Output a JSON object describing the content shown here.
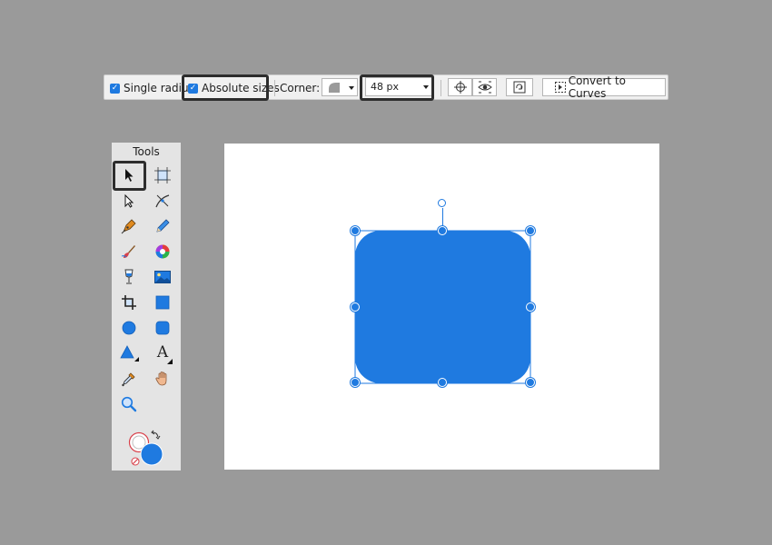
{
  "toolbar": {
    "single_radius": {
      "label": "Single radius",
      "checked": true
    },
    "absolute_sizes": {
      "label": "Absolute sizes",
      "checked": true
    },
    "corner_label": "Corner:",
    "radius_value": "48 px",
    "convert_label": "Convert to Curves"
  },
  "tools_panel": {
    "title": "Tools",
    "tools": [
      {
        "name": "move-tool-icon",
        "active": true
      },
      {
        "name": "artboard-tool-icon"
      },
      {
        "name": "node-tool-icon"
      },
      {
        "name": "corner-tool-icon"
      },
      {
        "name": "pen-tool-icon"
      },
      {
        "name": "pencil-tool-icon"
      },
      {
        "name": "brush-tool-icon"
      },
      {
        "name": "fill-tool-icon"
      },
      {
        "name": "transparency-tool-icon"
      },
      {
        "name": "place-image-tool-icon"
      },
      {
        "name": "crop-tool-icon"
      },
      {
        "name": "rectangle-tool-icon"
      },
      {
        "name": "ellipse-tool-icon"
      },
      {
        "name": "rounded-rectangle-tool-icon"
      },
      {
        "name": "triangle-tool-icon"
      },
      {
        "name": "text-tool-icon"
      },
      {
        "name": "color-picker-tool-icon"
      },
      {
        "name": "view-tool-icon"
      },
      {
        "name": "zoom-tool-icon"
      }
    ],
    "text_tool_glyph": "A"
  },
  "colors": {
    "accent": "#1f7ae0",
    "workspace": "#9a9a9a",
    "panel": "#e4e4e4",
    "canvas": "#ffffff"
  }
}
